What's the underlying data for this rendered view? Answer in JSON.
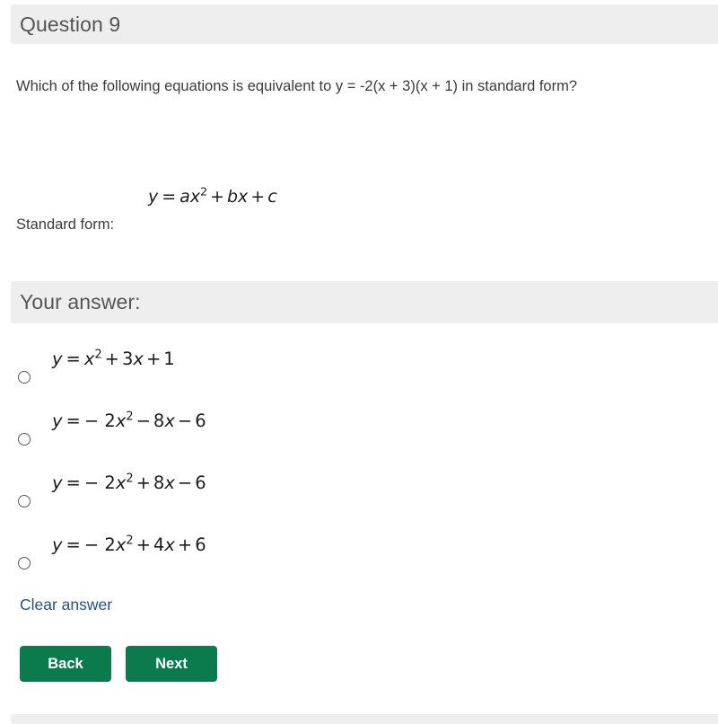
{
  "question_header": {
    "title": "Question 9"
  },
  "question": {
    "prompt": "Which of the following equations is equivalent to y = -2(x + 3)(x + 1) in standard form?"
  },
  "standard_form": {
    "label": "Standard form:",
    "formula_plain": "y = ax^2 + bx + c",
    "formula_parts": {
      "lhs": "y",
      "eq": "=",
      "a": "a",
      "x": "x",
      "exp": "2",
      "plus1": "+",
      "b": "b",
      "x2": "x",
      "plus2": "+",
      "c": "c"
    }
  },
  "answer_header": {
    "title": "Your answer:"
  },
  "options": [
    {
      "id": "option-1",
      "selected": false,
      "plain": "y = x^2 + 3x + 1",
      "parts": {
        "lhs": "y",
        "eq": "=",
        "coef": "",
        "x": "x",
        "exp": "2",
        "op1": "+",
        "b": "3",
        "x2": "x",
        "op2": "+",
        "c": "1"
      }
    },
    {
      "id": "option-2",
      "selected": false,
      "plain": "y = -2x^2 - 8x - 6",
      "parts": {
        "lhs": "y",
        "eq": "=",
        "coef": "− 2",
        "x": "x",
        "exp": "2",
        "op1": "−",
        "b": "8",
        "x2": "x",
        "op2": "−",
        "c": "6"
      }
    },
    {
      "id": "option-3",
      "selected": false,
      "plain": "y = -2x^2 + 8x - 6",
      "parts": {
        "lhs": "y",
        "eq": "=",
        "coef": "− 2",
        "x": "x",
        "exp": "2",
        "op1": "+",
        "b": "8",
        "x2": "x",
        "op2": "−",
        "c": "6"
      }
    },
    {
      "id": "option-4",
      "selected": false,
      "plain": "y = -2x^2 + 4x + 6",
      "parts": {
        "lhs": "y",
        "eq": "=",
        "coef": "− 2",
        "x": "x",
        "exp": "2",
        "op1": "+",
        "b": "4",
        "x2": "x",
        "op2": "+",
        "c": "6"
      }
    }
  ],
  "actions": {
    "clear_answer": "Clear answer",
    "back": "Back",
    "next": "Next"
  },
  "colors": {
    "band_background": "#eeeeee",
    "button_green": "#0b7a4d",
    "link_blue": "#1d5490",
    "text": "#3b3b3b"
  }
}
